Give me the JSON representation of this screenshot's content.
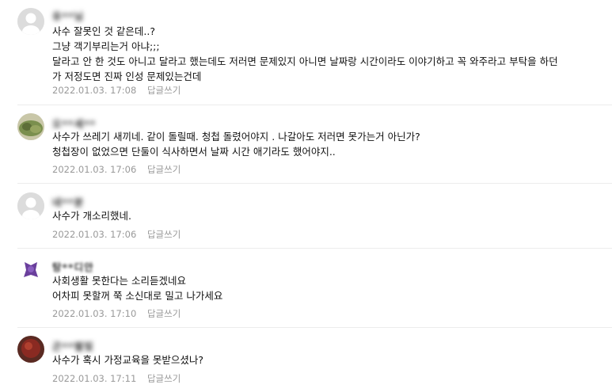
{
  "comments": [
    {
      "username": "유**님",
      "lines": [
        "사수 잘못인 것 같은데..?",
        "그냥 객기부리는거 아냐;;;",
        "달라고 안 한 것도 아니고 달라고 했는데도 저러면 문제있지 아니면 날짜랑 시간이라도 이야기하고 꼭 와주라고 부탁을 하던",
        "가 저정도면 진짜 인성 문제있는건데"
      ],
      "date": "2022.01.03. 17:08",
      "reply_label": "답글쓰기"
    },
    {
      "username": "오**세**",
      "lines": [
        "사수가 쓰레기 새끼네. 같이 돌릴때. 청첩 돌렸어야지 . 나갈아도 저러면 못가는거 아닌가?",
        "청첩장이 없었으면 단둘이 식사하면서 날짜 시간 애기라도 했어야지.."
      ],
      "date": "2022.01.03. 17:06",
      "reply_label": "답글쓰기"
    },
    {
      "username": "네**분",
      "lines": [
        "사수가 개소리했네."
      ],
      "date": "2022.01.03. 17:06",
      "reply_label": "답글쓰기"
    },
    {
      "username": "탕**디안",
      "lines": [
        "사회생활 못한다는 소리듣겠네요",
        "어차피 못할꺼 쭉 소신대로 밀고 나가세요"
      ],
      "date": "2022.01.03. 17:10",
      "reply_label": "답글쓰기"
    },
    {
      "username": "곤**별빛",
      "lines": [
        "사수가 혹시 가정교육을 못받으셨나?"
      ],
      "date": "2022.01.03. 17:11",
      "reply_label": "답글쓰기"
    }
  ],
  "avatars": [
    {
      "icon": "default-profile-icon",
      "color": "#d8d8d8"
    },
    {
      "icon": "profile-photo-green",
      "color": "#7a8f4e"
    },
    {
      "icon": "default-profile-icon",
      "color": "#d8d8d8"
    },
    {
      "icon": "profile-photo-purple",
      "color": "#6a3f9c"
    },
    {
      "icon": "profile-photo-red",
      "color": "#8a2a22"
    }
  ]
}
